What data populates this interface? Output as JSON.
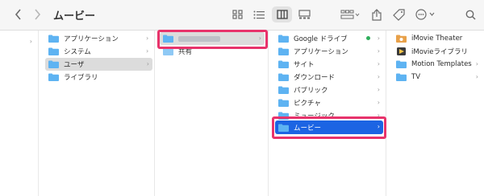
{
  "window": {
    "title": "ムービー"
  },
  "columns": {
    "col1": {
      "items": []
    },
    "col2": {
      "items": [
        {
          "label": "アプリケーション"
        },
        {
          "label": "システム"
        },
        {
          "label": "ユーザ"
        },
        {
          "label": "ライブラリ"
        }
      ]
    },
    "col3": {
      "items": [
        {
          "label": ""
        },
        {
          "label": "共有"
        }
      ]
    },
    "col4": {
      "items": [
        {
          "label": "Google ドライブ"
        },
        {
          "label": "アプリケーション"
        },
        {
          "label": "サイト"
        },
        {
          "label": "ダウンロード"
        },
        {
          "label": "パブリック"
        },
        {
          "label": "ピクチャ"
        },
        {
          "label": "ミュージック"
        },
        {
          "label": "ムービー"
        }
      ]
    },
    "col5": {
      "items": [
        {
          "label": "iMovie Theater"
        },
        {
          "label": "iMovieライブラリ"
        },
        {
          "label": "Motion Templates"
        },
        {
          "label": "TV"
        }
      ]
    }
  },
  "colors": {
    "folder": "#5eb3f2",
    "selected": "#1c64e3",
    "highlight": "#e8336b",
    "sync_dot": "#2fae5c"
  },
  "icons": {
    "back": "chevron-left-icon",
    "forward": "chevron-right-icon",
    "grid_view": "grid-view-icon",
    "list_view": "list-view-icon",
    "column_view": "column-view-icon",
    "gallery_view": "gallery-view-icon",
    "group": "group-icon",
    "share": "share-icon",
    "tag": "tag-icon",
    "more": "more-icon",
    "search": "search-icon"
  }
}
